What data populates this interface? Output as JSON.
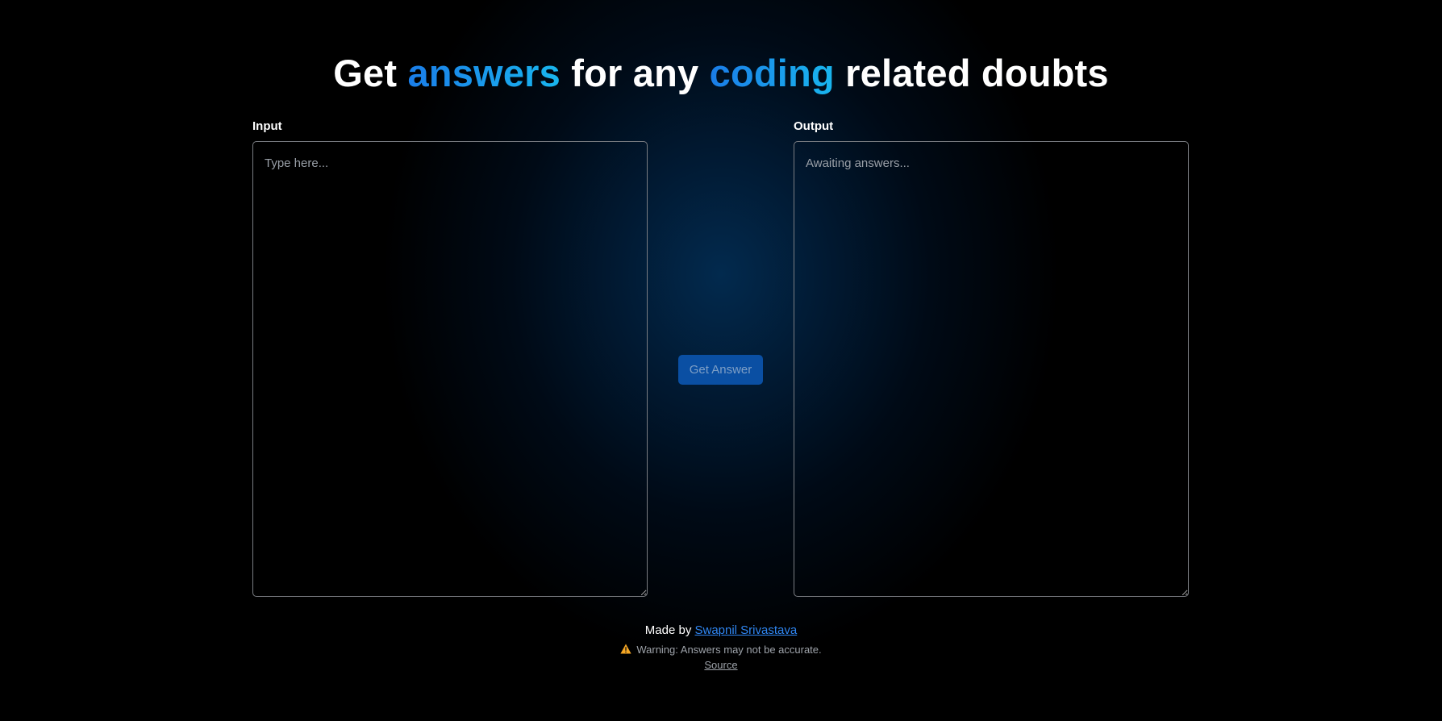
{
  "heading": {
    "part1": "Get ",
    "highlight1": "answers",
    "part2": " for any ",
    "highlight2": "coding",
    "part3": " related doubts"
  },
  "input_panel": {
    "label": "Input",
    "placeholder": "Type here...",
    "value": ""
  },
  "output_panel": {
    "label": "Output",
    "placeholder": "Awaiting answers...",
    "value": ""
  },
  "action": {
    "label": "Get Answer"
  },
  "footer": {
    "made_by_prefix": "Made by ",
    "author_link": "Swapnil Srivastava",
    "warning_icon": "warning-triangle-icon",
    "warning_text": "Warning: Answers may not be accurate.",
    "source_link": "Source"
  },
  "colors": {
    "background": "#000000",
    "glow": "#022a4e",
    "accent_gradient_start": "#1a7de8",
    "accent_gradient_end": "#19b6ee",
    "button_bg": "#0a4fa3",
    "link": "#2f86f2",
    "warning": "#f5a623"
  }
}
